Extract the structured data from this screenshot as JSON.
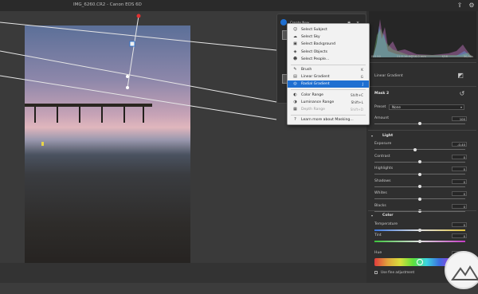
{
  "window": {
    "title": "IMG_6260.CR2  -  Canon EOS 6D"
  },
  "histogram": {
    "info": [
      "ISO 50",
      "11.0-16.0@16.0 mm",
      "f/16",
      "30,00s"
    ]
  },
  "mask_type_label": "Linear Gradient",
  "mask_name": "Mask 2",
  "preset": {
    "label": "Preset",
    "value": "None"
  },
  "amount": {
    "label": "Amount",
    "value": "100"
  },
  "light": {
    "section_label": "Light",
    "sliders": [
      {
        "label": "Exposure",
        "value": "-0.40",
        "level": 0.45
      },
      {
        "label": "Contrast",
        "value": "0",
        "level": 0.5
      },
      {
        "label": "Highlights",
        "value": "0",
        "level": 0.5
      },
      {
        "label": "Shadows",
        "value": "0",
        "level": 0.5
      },
      {
        "label": "Whites",
        "value": "0",
        "level": 0.5
      },
      {
        "label": "Blacks",
        "value": "0",
        "level": 0.5
      }
    ]
  },
  "color": {
    "section_label": "Color",
    "sliders": [
      {
        "label": "Temperature",
        "value": "0",
        "level": 0.5
      },
      {
        "label": "Tint",
        "value": "0",
        "level": 0.5
      }
    ],
    "hue": {
      "label": "Hue",
      "value": "0.0",
      "level": 0.5
    },
    "fine_adjust_label": "Use fine adjustment"
  },
  "mask_panel": {
    "label": "Create New"
  },
  "menu": {
    "groups": [
      [
        {
          "icon": "person-icon",
          "glyph": "☺",
          "label": "Select Subject",
          "shortcut": ""
        },
        {
          "icon": "cloud-icon",
          "glyph": "☁",
          "label": "Select Sky",
          "shortcut": ""
        },
        {
          "icon": "background-icon",
          "glyph": "▣",
          "label": "Select Background",
          "shortcut": ""
        },
        {
          "icon": "objects-icon",
          "glyph": "◈",
          "label": "Select Objects",
          "shortcut": ""
        },
        {
          "icon": "people-icon",
          "glyph": "☻",
          "label": "Select People...",
          "shortcut": ""
        }
      ],
      [
        {
          "icon": "brush-icon",
          "glyph": "✎",
          "label": "Brush",
          "shortcut": "K"
        },
        {
          "icon": "linear-gradient-icon",
          "glyph": "▤",
          "label": "Linear Gradient",
          "shortcut": "G"
        },
        {
          "icon": "radial-gradient-icon",
          "glyph": "◎",
          "label": "Radial Gradient",
          "shortcut": "J",
          "selected": true
        }
      ],
      [
        {
          "icon": "color-range-icon",
          "glyph": "◐",
          "label": "Color Range",
          "shortcut": "Shift+C"
        },
        {
          "icon": "luminance-range-icon",
          "glyph": "◑",
          "label": "Luminance Range",
          "shortcut": "Shift+L"
        },
        {
          "icon": "depth-range-icon",
          "glyph": "▦",
          "label": "Depth Range",
          "shortcut": "Shift+D",
          "disabled": true
        }
      ],
      [
        {
          "icon": "help-icon",
          "glyph": "?",
          "label": "Learn more about Masking...",
          "shortcut": ""
        }
      ]
    ]
  },
  "colors": {
    "accent": "#1f6fd1",
    "panel": "#2f2f2f",
    "workspace": "#3a3a3a"
  }
}
